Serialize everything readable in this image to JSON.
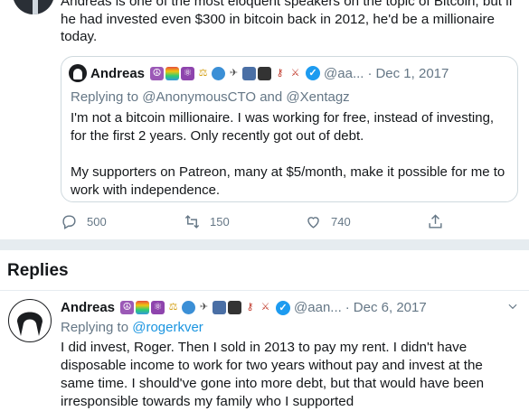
{
  "tweet": {
    "text": "Andreas is one of the most eloquent speakers on the topic of Bitcoin, but if he had invested even $300 in bitcoin back in 2012, he'd be a millionaire today."
  },
  "quoted": {
    "name": "Andreas",
    "handle": "@aa...",
    "separator": "·",
    "date": "Dec 1, 2017",
    "replying_prefix": "Replying to",
    "replying_to": "@AnonymousCTO and @Xentagz",
    "paragraphs": [
      "I'm not a bitcoin millionaire. I was working for free, instead of investing, for the first 2 years. Only recently got out of debt.",
      "My supporters on Patreon, many at $5/month, make it possible for me to work with independence."
    ]
  },
  "actions": {
    "reply_count": "500",
    "retweet_count": "150",
    "like_count": "740"
  },
  "replies_title": "Replies",
  "reply": {
    "name": "Andreas",
    "handle": "@aan...",
    "separator": "·",
    "date": "Dec 6, 2017",
    "replying_prefix": "Replying to",
    "replying_to": "@rogerkver",
    "text": "I did invest, Roger. Then I sold in 2013 to pay my rent. I didn't have disposable income to work for two years without pay and invest at the same time. I should've gone into more debt, but that would have been irresponsible towards my family who I supported"
  },
  "emoji_badges": [
    {
      "icon": "peace-icon",
      "glyph": "☮",
      "bg": "#9b59b6"
    },
    {
      "icon": "rainbow-icon",
      "glyph": "🌈",
      "bg": "transparent"
    },
    {
      "icon": "atom-icon",
      "glyph": "⚛",
      "bg": "#8e44ad"
    },
    {
      "icon": "scales-icon",
      "glyph": "⚖",
      "bg": "transparent"
    },
    {
      "icon": "globe-icon",
      "glyph": "🌐",
      "bg": "transparent"
    },
    {
      "icon": "satellite-icon",
      "glyph": "📡",
      "bg": "transparent"
    },
    {
      "icon": "book-icon",
      "glyph": "📖",
      "bg": "transparent"
    },
    {
      "icon": "camera-icon",
      "glyph": "🎬",
      "bg": "transparent"
    },
    {
      "icon": "key-icon",
      "glyph": "🔑",
      "bg": "transparent"
    },
    {
      "icon": "crossed-swords-icon",
      "glyph": "⚔",
      "bg": "transparent"
    }
  ],
  "colors": {
    "link": "#1b95e0",
    "muted": "#657786",
    "verified": "#1d9bf0",
    "divider": "#e6ecf0"
  }
}
